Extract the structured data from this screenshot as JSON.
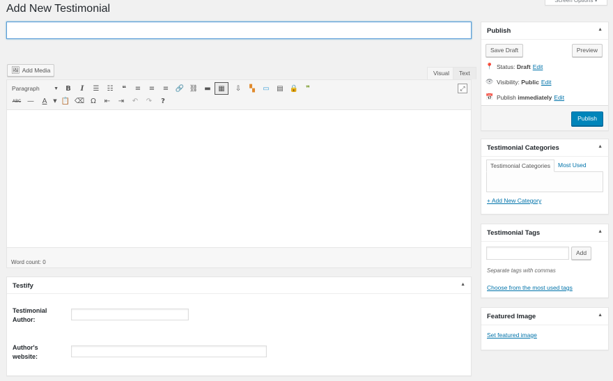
{
  "page": {
    "title": "Add New Testimonial",
    "screen_options": "Screen Options ▾"
  },
  "title_input": {
    "value": "",
    "placeholder": ""
  },
  "editor": {
    "add_media": "Add Media",
    "tabs": {
      "visual": "Visual",
      "text": "Text"
    },
    "format_select": "Paragraph",
    "word_count": "Word count: 0"
  },
  "testify": {
    "title": "Testify",
    "author_label_1": "Testimonial",
    "author_label_2": "Author:",
    "website_label_1": "Author's",
    "website_label_2": "website:"
  },
  "publish": {
    "title": "Publish",
    "save_draft": "Save Draft",
    "preview": "Preview",
    "status_label": "Status:",
    "status_value": "Draft",
    "visibility_label": "Visibility:",
    "visibility_value": "Public",
    "schedule_label": "Publish",
    "schedule_value": "immediately",
    "edit": "Edit",
    "publish_button": "Publish"
  },
  "categories": {
    "title": "Testimonial Categories",
    "tab_all": "Testimonial Categories",
    "tab_most_used": "Most Used",
    "add_new": "+ Add New Category"
  },
  "tags": {
    "title": "Testimonial Tags",
    "input_value": "",
    "add_button": "Add",
    "hint": "Separate tags with commas",
    "choose_link": "Choose from the most used tags"
  },
  "featured_image": {
    "title": "Featured Image",
    "set_link": "Set featured image"
  },
  "colors": {
    "accent": "#0085ba",
    "link": "#0073aa",
    "background": "#f1f1f1"
  }
}
